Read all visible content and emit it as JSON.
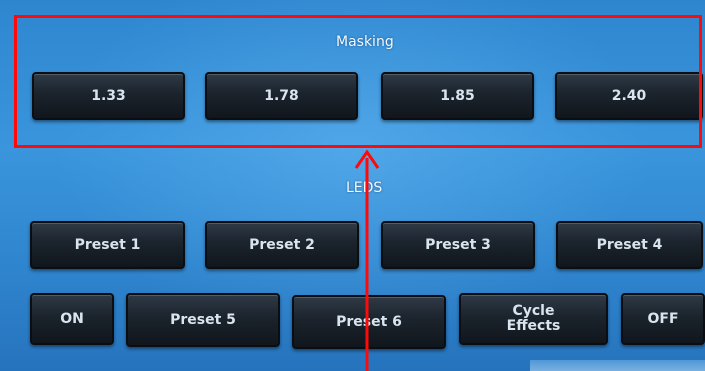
{
  "masking": {
    "title": "Masking",
    "buttons": [
      {
        "label": "1.33"
      },
      {
        "label": "1.78"
      },
      {
        "label": "1.85"
      },
      {
        "label": "2.40"
      }
    ]
  },
  "leds": {
    "title": "LEDS",
    "row1": [
      {
        "label": "Preset 1"
      },
      {
        "label": "Preset 2"
      },
      {
        "label": "Preset 3"
      },
      {
        "label": "Preset 4"
      }
    ],
    "row2": [
      {
        "label": "ON"
      },
      {
        "label": "Preset  5"
      },
      {
        "label": "Preset 6"
      },
      {
        "label": "Cycle\nEffects"
      },
      {
        "label": "OFF"
      }
    ]
  },
  "annotation": {
    "highlight_color": "#ff0a0a",
    "arrow_color": "#ff0a0a"
  }
}
